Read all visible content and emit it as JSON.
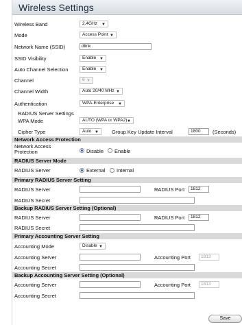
{
  "header": {
    "title": "Wireless Settings"
  },
  "general": {
    "wireless_band_label": "Wireless Band",
    "wireless_band_value": "2.4GHz",
    "mode_label": "Mode",
    "mode_value": "Access Point",
    "ssid_label": "Network Name (SSID)",
    "ssid_value": "dlink",
    "ssid_visibility_label": "SSID Visibility",
    "ssid_visibility_value": "Enable",
    "auto_channel_label": "Auto Channel Selection",
    "auto_channel_value": "Enable",
    "channel_label": "Channel",
    "channel_value": "6",
    "channel_width_label": "Channel Width",
    "channel_width_value": "Auto 20/40 MHz",
    "authentication_label": "Authentication",
    "authentication_value": "WPA-Enterprise"
  },
  "radius_settings": {
    "heading": "RADIUS Server Settings",
    "wpa_mode_label": "WPA Mode",
    "wpa_mode_value": "AUTO (WPA or WPA2)",
    "cipher_type_label": "Cipher Type",
    "cipher_type_value": "Auto",
    "group_key_label": "Group Key Update Interval",
    "group_key_value": "1800",
    "group_key_unit": "(Seconds)"
  },
  "nap": {
    "heading": "Network Access Protection",
    "label": "Network Access\nProtection",
    "opt_disable": "Disable",
    "opt_enable": "Enable"
  },
  "radius_mode": {
    "heading": "RADIUS Server Mode",
    "label": "RADIUS Server",
    "opt_external": "External",
    "opt_internal": "Internal"
  },
  "primary_radius": {
    "heading": "Primary RADIUS Server Setting",
    "server_label": "RADIUS Server",
    "server_value": "",
    "port_label": "RADIUS Port",
    "port_value": "1812",
    "secret_label": "RADIUS Secret",
    "secret_value": ""
  },
  "backup_radius": {
    "heading": "Backup RADIUS Server Setting (Optional)",
    "server_label": "RADIUS Server",
    "server_value": "",
    "port_label": "RADIUS Port",
    "port_value": "1812",
    "secret_label": "RADIUS Secret",
    "secret_value": ""
  },
  "primary_accounting": {
    "heading": "Primary Accounting Server Setting",
    "mode_label": "Accounting Mode",
    "mode_value": "Disable",
    "server_label": "Accounting Server",
    "server_value": "",
    "port_label": "Accounting Port",
    "port_value": "1813",
    "secret_label": "Accounting Secret",
    "secret_value": ""
  },
  "backup_accounting": {
    "heading": "Backup Accounting Server Setting (Optional)",
    "server_label": "Accounting Server",
    "server_value": "",
    "port_label": "Accounting Port",
    "port_value": "1813",
    "secret_label": "Accounting Secret",
    "secret_value": ""
  },
  "actions": {
    "save_label": "Save"
  },
  "icons": {
    "dropdown": "chevron-down-icon",
    "caret_glyph": "▼"
  }
}
